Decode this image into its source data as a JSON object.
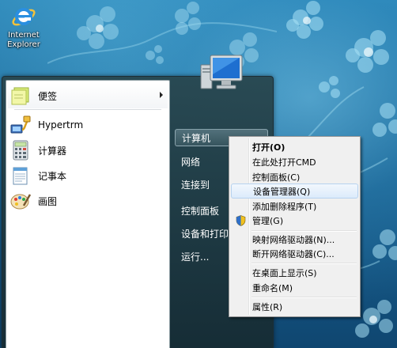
{
  "desktop": {
    "icons": [
      {
        "name": "ie",
        "label": "Internet\nExplorer"
      }
    ]
  },
  "start_menu": {
    "pinned": [
      {
        "label": "便签",
        "icon": "sticky-notes-icon",
        "has_submenu": true
      }
    ],
    "programs": [
      {
        "label": "Hypertrm",
        "icon": "hyperterminal-icon"
      },
      {
        "label": "计算器",
        "icon": "calculator-icon"
      },
      {
        "label": "记事本",
        "icon": "notepad-icon"
      },
      {
        "label": "画图",
        "icon": "paint-icon"
      }
    ],
    "right_items": [
      {
        "label": "计算机",
        "selected": true
      },
      {
        "label": "网络"
      },
      {
        "label": "连接到"
      },
      {
        "label": "控制面板"
      },
      {
        "label": "设备和打印机"
      },
      {
        "label": "运行..."
      }
    ]
  },
  "context_menu": {
    "items": [
      {
        "label": "打开(O)",
        "bold": true
      },
      {
        "label": "在此处打开CMD"
      },
      {
        "label": "控制面板(C)"
      },
      {
        "label": "设备管理器(Q)",
        "hover": true
      },
      {
        "label": "添加删除程序(T)"
      },
      {
        "label": "管理(G)",
        "icon": "uac-shield-icon"
      },
      {
        "label": "映射网络驱动器(N)..."
      },
      {
        "label": "断开网络驱动器(C)..."
      },
      {
        "label": "在桌面上显示(S)"
      },
      {
        "label": "重命名(M)"
      },
      {
        "label": "属性(R)"
      }
    ]
  },
  "colors": {
    "desktop_bg": "#1f6e9e",
    "menu_hover": "#dcebfb",
    "menu_bg": "#f0f0f0"
  }
}
